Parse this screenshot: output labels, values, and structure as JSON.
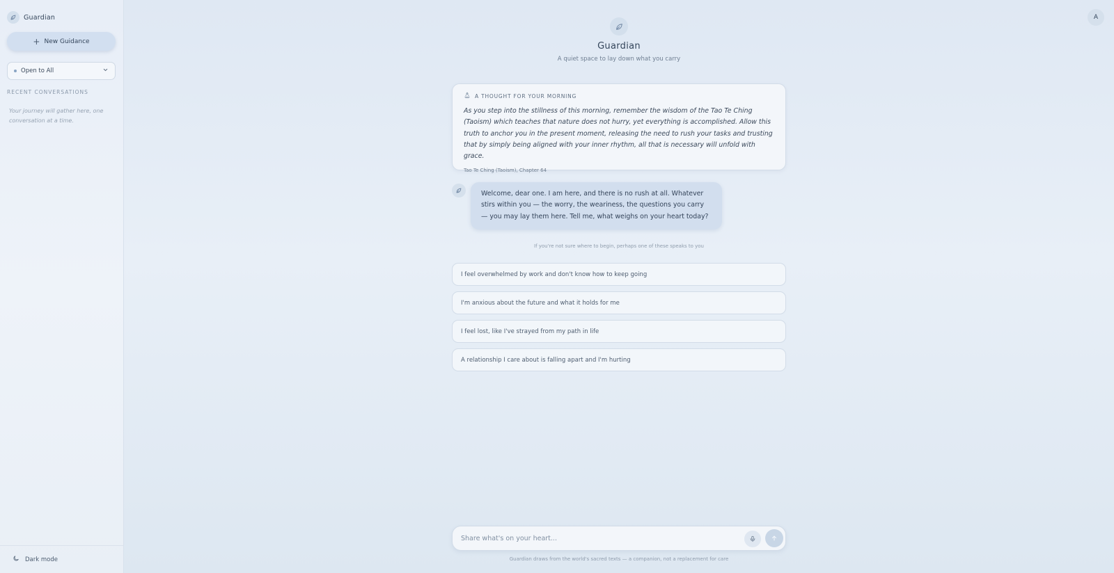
{
  "sidebar": {
    "brand_name": "Guardian",
    "new_button_label": "New Guidance",
    "filter_selected": "Open to All",
    "recent_title": "RECENT CONVERSATIONS",
    "empty_note": "Your journey will gather here, one conversation at a time.",
    "dark_mode_label": "Dark mode"
  },
  "header": {
    "title": "Guardian",
    "subtitle": "A quiet space to lay down what you carry"
  },
  "user": {
    "avatar_initial": "A"
  },
  "quote": {
    "heading": "A THOUGHT FOR YOUR MORNING",
    "text": "As you step into the stillness of this morning, remember the wisdom of the Tao Te Ching (Taoism) which teaches that nature does not hurry, yet everything is accomplished. Allow this truth to anchor you in the present moment, releasing the need to rush your tasks and trusting that by simply being aligned with your inner rhythm, all that is necessary will unfold with grace.",
    "source": "Tao Te Ching (Taoism), Chapter 64"
  },
  "message": {
    "text": "Welcome, dear one. I am here, and there is no rush at all. Whatever stirs within you — the worry, the weariness, the questions you carry — you may lay them here. Tell me, what weighs on your heart today?"
  },
  "suggestions": {
    "hint": "If you're not sure where to begin, perhaps one of these speaks to you",
    "items": [
      "I feel overwhelmed by work and don't know how to keep going",
      "I'm anxious about the future and what it holds for me",
      "I feel lost, like I've strayed from my path in life",
      "A relationship I care about is falling apart and I'm hurting"
    ]
  },
  "composer": {
    "placeholder": "Share what's on your heart...",
    "disclaimer": "Guardian draws from the world's sacred texts — a companion, not a replacement for care"
  }
}
